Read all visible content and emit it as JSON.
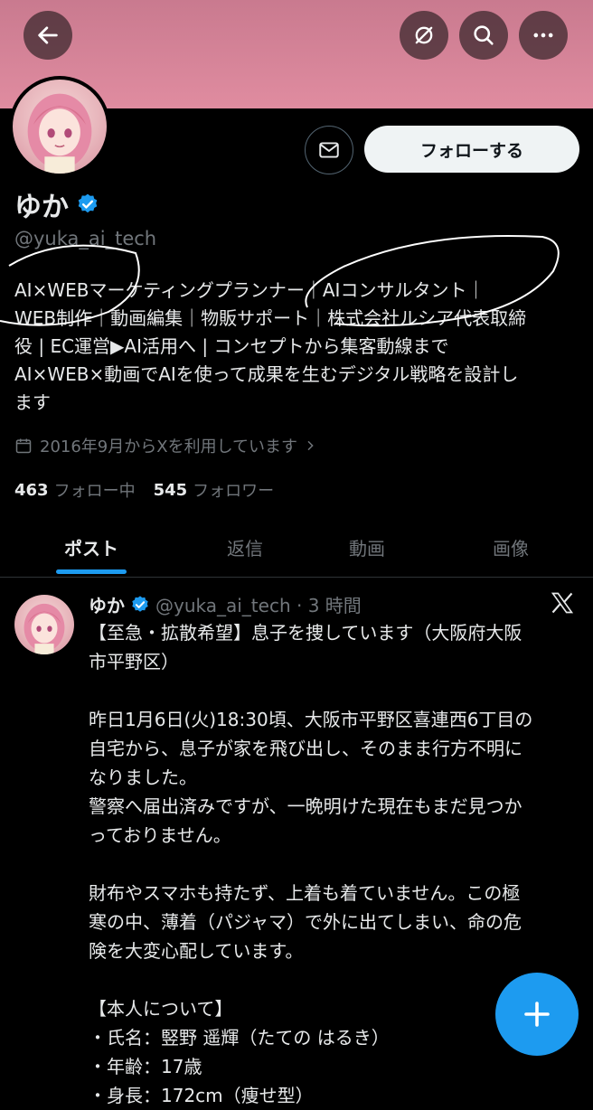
{
  "header": {
    "back_icon": "arrow-left-icon",
    "grok_icon": "grok-icon",
    "search_icon": "search-icon",
    "more_icon": "more-horizontal-icon",
    "banner_color": "#e08ca0"
  },
  "profile": {
    "name": "ゆか",
    "handle": "@yuka_ai_tech",
    "follow_label": "フォローする",
    "message_icon": "mail-icon",
    "bio_lines": [
      "AI×WEBマーケティングプランナー｜AIコンサルタント｜",
      "WEB制作｜動画編集｜物販サポート｜株式会社ルシア代表取締",
      "役 | EC運営▶AI活用へ | コンセプトから集客動線まで",
      "AI×WEB×動画でAIを使って成果を生むデジタル戦略を設計し",
      "ます"
    ],
    "joined": "2016年9月からXを利用しています",
    "following_count": "463",
    "following_label": "フォロー中",
    "followers_count": "545",
    "followers_label": "フォロワー"
  },
  "tabs": [
    {
      "label": "ポスト"
    },
    {
      "label": "返信"
    },
    {
      "label": "動画"
    },
    {
      "label": "画像"
    }
  ],
  "post": {
    "name": "ゆか",
    "handle_time": "@yuka_ai_tech · 3 時間",
    "lines": [
      "【至急・拡散希望】息子を捜しています（大阪府大阪",
      "市平野区）",
      "",
      "昨日1月6日(火)18:30頃、大阪市平野区喜連西6丁目の",
      "自宅から、息子が家を飛び出し、そのまま行方不明に",
      "なりました。",
      "警察へ届出済みですが、一晩明けた現在もまだ見つか",
      "っておりません。",
      "",
      "財布やスマホも持たず、上着も着ていません。この極",
      "寒の中、薄着（パジャマ）で外に出てしまい、命の危",
      "険を大変心配しています。",
      "",
      "【本人について】",
      "・氏名：竪野 遥輝（たての はるき）",
      "・年齢：17歳",
      "・身長：172cm（痩せ型）"
    ]
  },
  "fab": {
    "icon": "plus-icon"
  },
  "colors": {
    "accent": "#1d9bf0",
    "verified": "#1d9bf0",
    "muted": "#71767b"
  }
}
